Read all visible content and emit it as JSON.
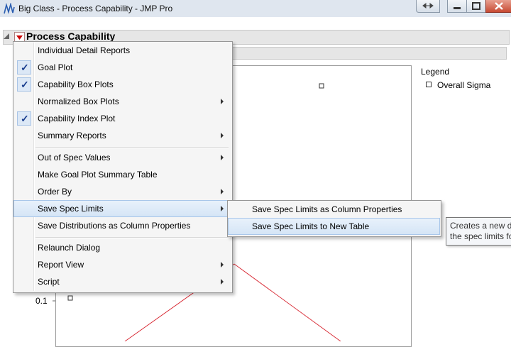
{
  "window": {
    "title": "Big Class - Process Capability - JMP Pro"
  },
  "report": {
    "section_title": "Process Capability"
  },
  "plot": {
    "tick_label": "0.1",
    "legend_title": "Legend",
    "legend_item": "Overall Sigma"
  },
  "menu": {
    "items": [
      {
        "label": "Individual Detail Reports",
        "checked": false,
        "submenu": false
      },
      {
        "label": "Goal Plot",
        "checked": true,
        "submenu": false
      },
      {
        "label": "Capability Box Plots",
        "checked": true,
        "submenu": false
      },
      {
        "label": "Normalized Box Plots",
        "checked": false,
        "submenu": true
      },
      {
        "label": "Capability Index Plot",
        "checked": true,
        "submenu": false
      },
      {
        "label": "Summary Reports",
        "checked": false,
        "submenu": true
      },
      {
        "label": "Out of Spec Values",
        "checked": false,
        "submenu": true
      },
      {
        "label": "Make Goal Plot Summary Table",
        "checked": false,
        "submenu": false
      },
      {
        "label": "Order By",
        "checked": false,
        "submenu": true
      },
      {
        "label": "Save Spec Limits",
        "checked": false,
        "submenu": true,
        "highlighted": true
      },
      {
        "label": "Save Distributions as Column Properties",
        "checked": false,
        "submenu": false
      },
      {
        "label": "Relaunch Dialog",
        "checked": false,
        "submenu": false
      },
      {
        "label": "Report View",
        "checked": false,
        "submenu": true
      },
      {
        "label": "Script",
        "checked": false,
        "submenu": true
      }
    ]
  },
  "submenu": {
    "items": [
      {
        "label": "Save Spec Limits as Column Properties"
      },
      {
        "label": "Save Spec Limits to New Table",
        "highlighted": true
      }
    ]
  },
  "tooltip": {
    "line1": "Creates a new da",
    "line2": "the spec limits fo"
  },
  "colors": {
    "menu_highlight": "#d5e5f6",
    "check_mark": "#1b3f8f",
    "plot_line": "#d9303a",
    "hotspot_red": "#cc0000"
  }
}
